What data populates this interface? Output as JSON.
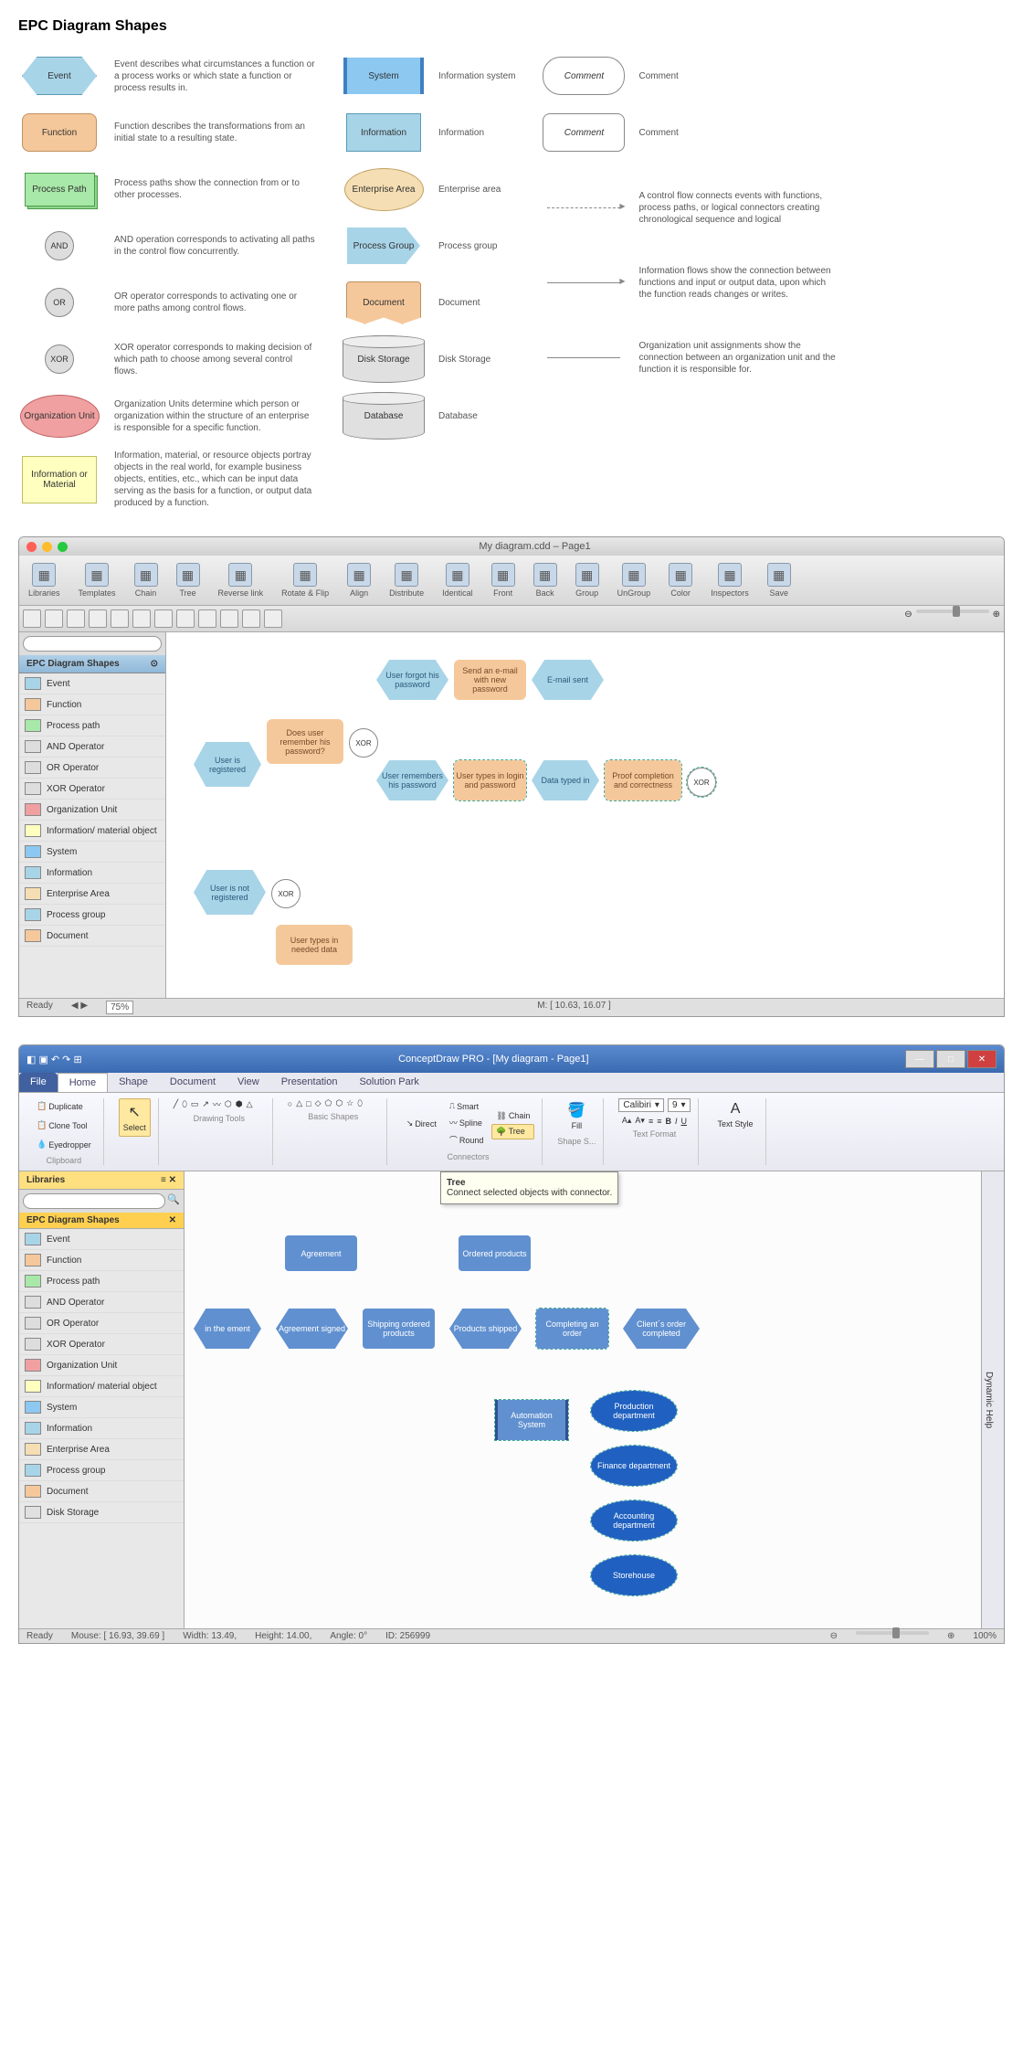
{
  "title": "EPC Diagram Shapes",
  "legend_left": [
    {
      "label": "Event",
      "desc": "Event describes what circumstances a function or a process works or which state a function or process results in."
    },
    {
      "label": "Function",
      "desc": "Function describes the transformations from an initial state to a resulting state."
    },
    {
      "label": "Process Path",
      "desc": "Process paths show the connection from or to other processes."
    },
    {
      "label": "AND",
      "desc": "AND operation corresponds to activating all paths in the control flow concurrently."
    },
    {
      "label": "OR",
      "desc": "OR operator corresponds to activating one or more paths among control flows."
    },
    {
      "label": "XOR",
      "desc": "XOR operator corresponds to making decision of which path to choose among several control flows."
    },
    {
      "label": "Organization Unit",
      "desc": "Organization Units determine which person or organization within the structure of an enterprise is responsible for a specific function."
    },
    {
      "label": "Information or Material",
      "desc": "Information, material, or resource objects portray objects in the real world, for example business objects, entities, etc., which can be input data serving as the basis for a function, or output data produced by a function."
    }
  ],
  "legend_mid": [
    {
      "label": "System",
      "desc": "Information system"
    },
    {
      "label": "Information",
      "desc": "Information"
    },
    {
      "label": "Enterprise Area",
      "desc": "Enterprise area"
    },
    {
      "label": "Process Group",
      "desc": "Process group"
    },
    {
      "label": "Document",
      "desc": "Document"
    },
    {
      "label": "Disk Storage",
      "desc": "Disk Storage"
    },
    {
      "label": "Database",
      "desc": "Database"
    }
  ],
  "legend_right": [
    {
      "label": "Comment",
      "desc": "Comment"
    },
    {
      "label": "Comment",
      "desc": "Comment"
    },
    {
      "label": "",
      "desc": "A control flow connects events with functions, process paths, or logical connectors creating chronological sequence and logical"
    },
    {
      "label": "",
      "desc": "Information flows show the connection between functions and input or output data, upon which the function reads changes or writes."
    },
    {
      "label": "",
      "desc": "Organization unit assignments show the connection between an organization unit and the function it is responsible for."
    }
  ],
  "mac": {
    "title": "My diagram.cdd – Page1",
    "toolbar": [
      "Libraries",
      "Templates",
      "Chain",
      "Tree",
      "Reverse link",
      "Rotate & Flip",
      "Align",
      "Distribute",
      "Identical",
      "Front",
      "Back",
      "Group",
      "UnGroup",
      "Color",
      "Inspectors",
      "Save"
    ],
    "panel_title": "EPC Diagram Shapes",
    "shapes": [
      "Event",
      "Function",
      "Process path",
      "AND Operator",
      "OR Operator",
      "XOR Operator",
      "Organization Unit",
      "Information/ material object",
      "System",
      "Information",
      "Enterprise Area",
      "Process group",
      "Document"
    ],
    "canvas": {
      "user_registered": "User is registered",
      "does_user": "Does user remember his password?",
      "xor": "XOR",
      "forgot": "User forgot his password",
      "send_email": "Send an e-mail with new password",
      "email_sent": "E-mail sent",
      "remembers": "User remembers his password",
      "types_login": "User types in login and password",
      "data_typed": "Data typed in",
      "proof": "Proof completion and correctness",
      "not_registered": "User is not registered",
      "types_data": "User types in needed data"
    },
    "zoom": "75%",
    "status": "Ready",
    "mouse": "M: [ 10.63, 16.07 ]"
  },
  "win": {
    "title": "ConceptDraw PRO - [My diagram - Page1]",
    "tabs": [
      "File",
      "Home",
      "Shape",
      "Document",
      "View",
      "Presentation",
      "Solution Park"
    ],
    "clipboard": {
      "label": "Clipboard",
      "items": [
        "Duplicate",
        "Clone Tool",
        "Eyedropper"
      ]
    },
    "select": "Select",
    "drawing": "Drawing Tools",
    "basic": "Basic Shapes",
    "connectors": {
      "label": "Connectors",
      "items": [
        "Direct",
        "Smart",
        "Spline",
        "Round",
        "Chain",
        "Tree"
      ]
    },
    "fill": "Fill",
    "shape_s": "Shape S...",
    "font": "Calibiri",
    "fontsize": "9",
    "textformat": "Text Format",
    "textstyle": "Text Style",
    "tooltip": {
      "title": "Tree",
      "desc": "Connect selected objects with connector."
    },
    "lib": "Libraries",
    "lib2": "EPC Diagram Shapes",
    "shapes": [
      "Event",
      "Function",
      "Process path",
      "AND Operator",
      "OR Operator",
      "XOR Operator",
      "Organization Unit",
      "Information/ material object",
      "System",
      "Information",
      "Enterprise Area",
      "Process group",
      "Document",
      "Disk Storage"
    ],
    "canvas": {
      "agreement": "Agreement",
      "in_the": "in the ement",
      "signed": "Agreement signed",
      "shipping": "Shipping ordered products",
      "ordered": "Ordered products",
      "shipped": "Products shipped",
      "completing": "Completing an order",
      "client": "Client´s order completed",
      "automation": "Automation System",
      "prod": "Production department",
      "finance": "Finance department",
      "acct": "Accounting department",
      "store": "Storehouse"
    },
    "status": {
      "ready": "Ready",
      "mouse": "Mouse: [ 16.93, 39.69 ]",
      "width": "Width: 13.49,",
      "height": "Height: 14.00,",
      "angle": "Angle: 0°",
      "id": "ID: 256999",
      "zoom": "100%"
    },
    "help": "Dynamic Help"
  }
}
